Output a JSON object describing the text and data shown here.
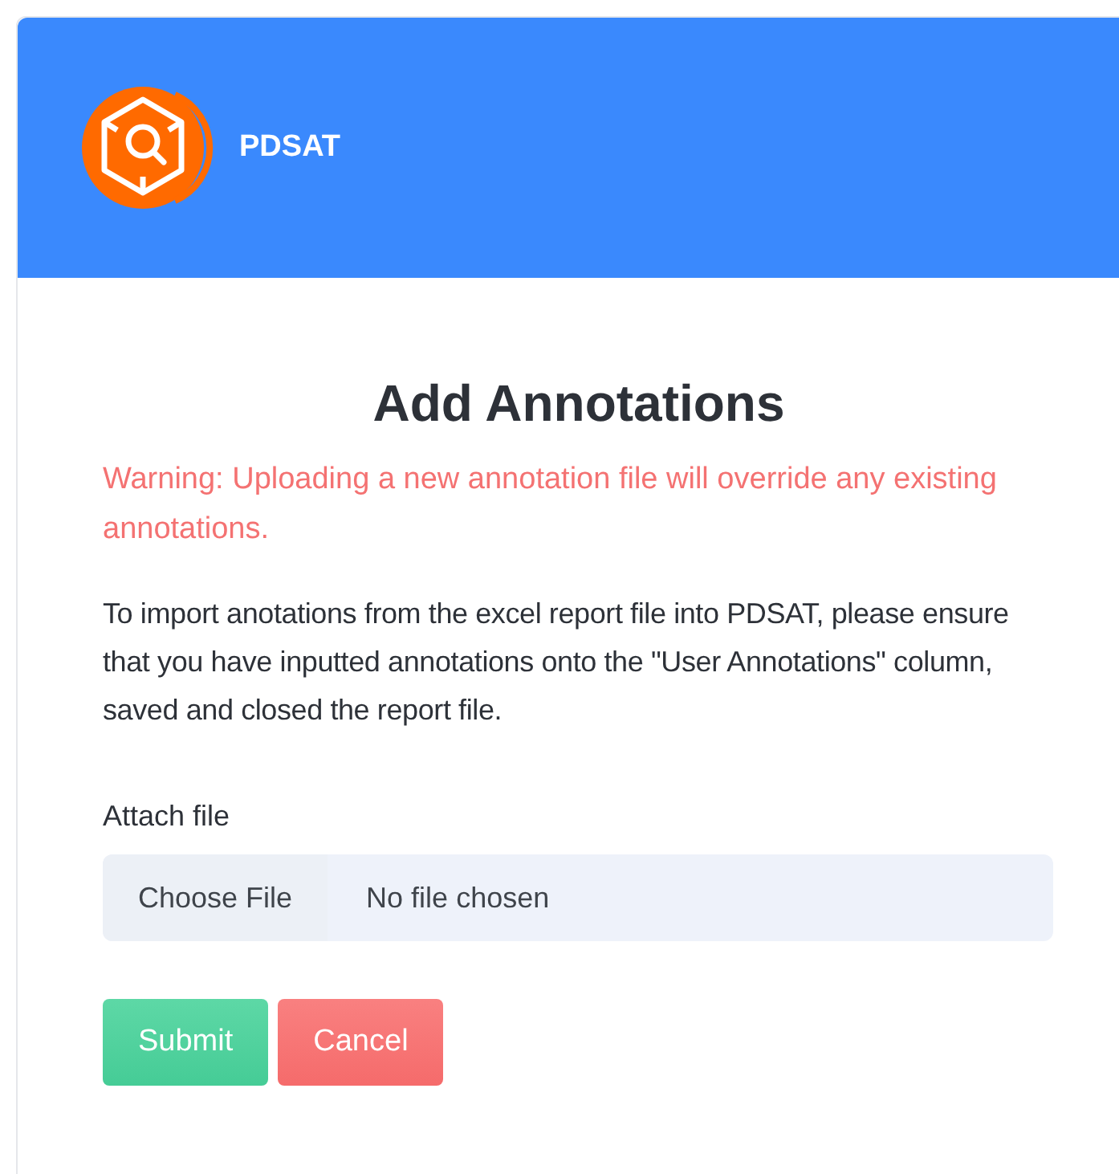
{
  "header": {
    "brand": "PDSAT"
  },
  "title": "Add Annotations",
  "warning": "Warning: Uploading a new annotation file will override any existing annotations.",
  "instructions": "To import anotations from the excel report file into PDSAT, please ensure that you have inputted annotations onto the \"User Annotations\" column, saved and closed the report file.",
  "file_field": {
    "label": "Attach file",
    "button": "Choose File",
    "status": "No file chosen"
  },
  "buttons": [
    {
      "label": "Submit",
      "kind": "primary"
    },
    {
      "label": "Cancel",
      "kind": "danger"
    }
  ]
}
